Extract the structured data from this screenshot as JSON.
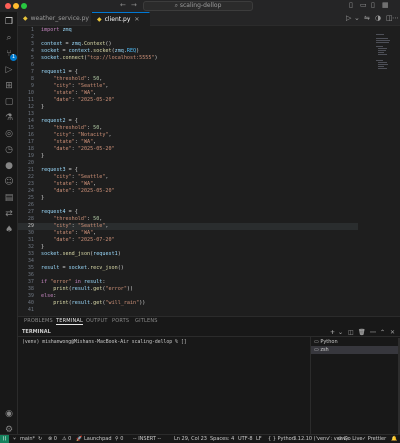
{
  "window": {
    "search_text": "scaling-dellop",
    "nav_back": "←",
    "nav_forward": "→"
  },
  "tabs": [
    {
      "label": "weather_service.py",
      "active": false
    },
    {
      "label": "client.py",
      "active": true
    }
  ],
  "editor": {
    "current_line": 29,
    "lines": [
      {
        "n": "1",
        "tokens": [
          [
            "kw",
            "import "
          ],
          [
            "var",
            "zmq"
          ]
        ]
      },
      {
        "n": "2",
        "tokens": []
      },
      {
        "n": "3",
        "tokens": [
          [
            "var",
            "context"
          ],
          [
            "pun",
            " = "
          ],
          [
            "var",
            "zmq"
          ],
          [
            "pun",
            "."
          ],
          [
            "fn",
            "Context"
          ],
          [
            "pun",
            "()"
          ]
        ]
      },
      {
        "n": "4",
        "tokens": [
          [
            "var",
            "socket"
          ],
          [
            "pun",
            " = "
          ],
          [
            "var",
            "context"
          ],
          [
            "pun",
            "."
          ],
          [
            "fn",
            "socket"
          ],
          [
            "pun",
            "("
          ],
          [
            "var",
            "zmq"
          ],
          [
            "pun",
            "."
          ],
          [
            "con",
            "REQ"
          ],
          [
            "pun",
            ")"
          ]
        ]
      },
      {
        "n": "5",
        "tokens": [
          [
            "var",
            "socket"
          ],
          [
            "pun",
            "."
          ],
          [
            "fn",
            "connect"
          ],
          [
            "pun",
            "("
          ],
          [
            "str",
            "\"tcp://localhost:5555\""
          ],
          [
            "pun",
            ")"
          ]
        ]
      },
      {
        "n": "6",
        "tokens": []
      },
      {
        "n": "7",
        "tokens": [
          [
            "var",
            "request1"
          ],
          [
            "pun",
            " = {"
          ]
        ]
      },
      {
        "n": "8",
        "tokens": [
          [
            "str",
            "    \"threshold\""
          ],
          [
            "pun",
            ": "
          ],
          [
            "num",
            "50"
          ],
          [
            "pun",
            ","
          ]
        ]
      },
      {
        "n": "9",
        "tokens": [
          [
            "str",
            "    \"city\""
          ],
          [
            "pun",
            ": "
          ],
          [
            "str",
            "\"Seattle\""
          ],
          [
            "pun",
            ","
          ]
        ]
      },
      {
        "n": "10",
        "tokens": [
          [
            "str",
            "    \"state\""
          ],
          [
            "pun",
            ": "
          ],
          [
            "str",
            "\"WA\""
          ],
          [
            "pun",
            ","
          ]
        ]
      },
      {
        "n": "11",
        "tokens": [
          [
            "str",
            "    \"date\""
          ],
          [
            "pun",
            ": "
          ],
          [
            "str",
            "\"2025-05-20\""
          ]
        ]
      },
      {
        "n": "12",
        "tokens": [
          [
            "pun",
            "}"
          ]
        ]
      },
      {
        "n": "13",
        "tokens": []
      },
      {
        "n": "14",
        "tokens": [
          [
            "var",
            "request2"
          ],
          [
            "pun",
            " = {"
          ]
        ]
      },
      {
        "n": "15",
        "tokens": [
          [
            "str",
            "    \"threshold\""
          ],
          [
            "pun",
            ": "
          ],
          [
            "num",
            "50"
          ],
          [
            "pun",
            ","
          ]
        ]
      },
      {
        "n": "16",
        "tokens": [
          [
            "str",
            "    \"city\""
          ],
          [
            "pun",
            ": "
          ],
          [
            "str",
            "\"Notacity\""
          ],
          [
            "pun",
            ","
          ]
        ]
      },
      {
        "n": "17",
        "tokens": [
          [
            "str",
            "    \"state\""
          ],
          [
            "pun",
            ": "
          ],
          [
            "str",
            "\"WA\""
          ],
          [
            "pun",
            ","
          ]
        ]
      },
      {
        "n": "18",
        "tokens": [
          [
            "str",
            "    \"date\""
          ],
          [
            "pun",
            ": "
          ],
          [
            "str",
            "\"2025-05-20\""
          ]
        ]
      },
      {
        "n": "19",
        "tokens": [
          [
            "pun",
            "}"
          ]
        ]
      },
      {
        "n": "20",
        "tokens": []
      },
      {
        "n": "21",
        "tokens": [
          [
            "var",
            "request3"
          ],
          [
            "pun",
            " = {"
          ]
        ]
      },
      {
        "n": "22",
        "tokens": [
          [
            "str",
            "    \"city\""
          ],
          [
            "pun",
            ": "
          ],
          [
            "str",
            "\"Seattle\""
          ],
          [
            "pun",
            ","
          ]
        ]
      },
      {
        "n": "23",
        "tokens": [
          [
            "str",
            "    \"state\""
          ],
          [
            "pun",
            ": "
          ],
          [
            "str",
            "\"WA\""
          ],
          [
            "pun",
            ","
          ]
        ]
      },
      {
        "n": "24",
        "tokens": [
          [
            "str",
            "    \"date\""
          ],
          [
            "pun",
            ": "
          ],
          [
            "str",
            "\"2025-05-20\""
          ]
        ]
      },
      {
        "n": "25",
        "tokens": [
          [
            "pun",
            "}"
          ]
        ]
      },
      {
        "n": "26",
        "tokens": []
      },
      {
        "n": "27",
        "tokens": [
          [
            "var",
            "request4"
          ],
          [
            "pun",
            " = {"
          ]
        ]
      },
      {
        "n": "28",
        "tokens": [
          [
            "str",
            "    \"threshold\""
          ],
          [
            "pun",
            ": "
          ],
          [
            "num",
            "50"
          ],
          [
            "pun",
            ","
          ]
        ]
      },
      {
        "n": "29",
        "tokens": [
          [
            "str",
            "    \"city\""
          ],
          [
            "pun",
            ": "
          ],
          [
            "str",
            "\"Seattle\""
          ],
          [
            "pun",
            ","
          ]
        ]
      },
      {
        "n": "30",
        "tokens": [
          [
            "str",
            "    \"state\""
          ],
          [
            "pun",
            ": "
          ],
          [
            "str",
            "\"WA\""
          ],
          [
            "pun",
            ","
          ]
        ]
      },
      {
        "n": "31",
        "tokens": [
          [
            "str",
            "    \"date\""
          ],
          [
            "pun",
            ": "
          ],
          [
            "str",
            "\"2025-07-20\""
          ]
        ]
      },
      {
        "n": "32",
        "tokens": [
          [
            "pun",
            "}"
          ]
        ]
      },
      {
        "n": "33",
        "tokens": [
          [
            "var",
            "socket"
          ],
          [
            "pun",
            "."
          ],
          [
            "fn",
            "send_json"
          ],
          [
            "pun",
            "("
          ],
          [
            "var",
            "request1"
          ],
          [
            "pun",
            ")"
          ]
        ]
      },
      {
        "n": "34",
        "tokens": []
      },
      {
        "n": "35",
        "tokens": [
          [
            "var",
            "result"
          ],
          [
            "pun",
            " = "
          ],
          [
            "var",
            "socket"
          ],
          [
            "pun",
            "."
          ],
          [
            "fn",
            "recv_json"
          ],
          [
            "pun",
            "()"
          ]
        ]
      },
      {
        "n": "36",
        "tokens": []
      },
      {
        "n": "37",
        "tokens": [
          [
            "kw",
            "if "
          ],
          [
            "str",
            "\"error\""
          ],
          [
            "kw",
            " in "
          ],
          [
            "var",
            "result"
          ],
          [
            "pun",
            ":"
          ]
        ]
      },
      {
        "n": "38",
        "tokens": [
          [
            "fn",
            "    print"
          ],
          [
            "pun",
            "("
          ],
          [
            "var",
            "result"
          ],
          [
            "pun",
            "."
          ],
          [
            "fn",
            "get"
          ],
          [
            "pun",
            "("
          ],
          [
            "str",
            "\"error\""
          ],
          [
            "pun",
            "))"
          ]
        ]
      },
      {
        "n": "39",
        "tokens": [
          [
            "kw",
            "else"
          ],
          [
            "pun",
            ":"
          ]
        ]
      },
      {
        "n": "40",
        "tokens": [
          [
            "fn",
            "    print"
          ],
          [
            "pun",
            "("
          ],
          [
            "var",
            "result"
          ],
          [
            "pun",
            "."
          ],
          [
            "fn",
            "get"
          ],
          [
            "pun",
            "("
          ],
          [
            "str",
            "\"will_rain\""
          ],
          [
            "pun",
            "))"
          ]
        ]
      },
      {
        "n": "41",
        "tokens": []
      }
    ]
  },
  "panel": {
    "tabs": [
      "PROBLEMS",
      "TERMINAL",
      "OUTPUT",
      "PORTS",
      "GITLENS"
    ],
    "active_tab": "TERMINAL",
    "terminal_title": "TERMINAL",
    "prompt": "(venv) mishanwong@Mishans-MacBook-Air scaling-dellop % ",
    "cursor": "[]",
    "terminals": [
      {
        "label": "Python",
        "active": false
      },
      {
        "label": "zsh",
        "active": true
      }
    ]
  },
  "statusbar": {
    "branch": "main*",
    "sync": "↻",
    "errors": "⊗ 0",
    "warnings": "⚠ 0",
    "launchpad": "Launchpad",
    "ports": "⚲ 0",
    "mode": "-- INSERT --",
    "position": "Ln 29, Col 23",
    "spaces": "Spaces: 4",
    "encoding": "UTF-8",
    "eol": "LF",
    "language": "{ } Python",
    "interpreter": "3.12.10 ('venv': venv)",
    "golive": "⊙ Go Live",
    "prettier": "✓ Prettier",
    "bell": "🔔"
  },
  "colors": {
    "accent": "#0078d4",
    "remote_bg": "#16825d",
    "editor_bg": "#1e1e1e"
  }
}
